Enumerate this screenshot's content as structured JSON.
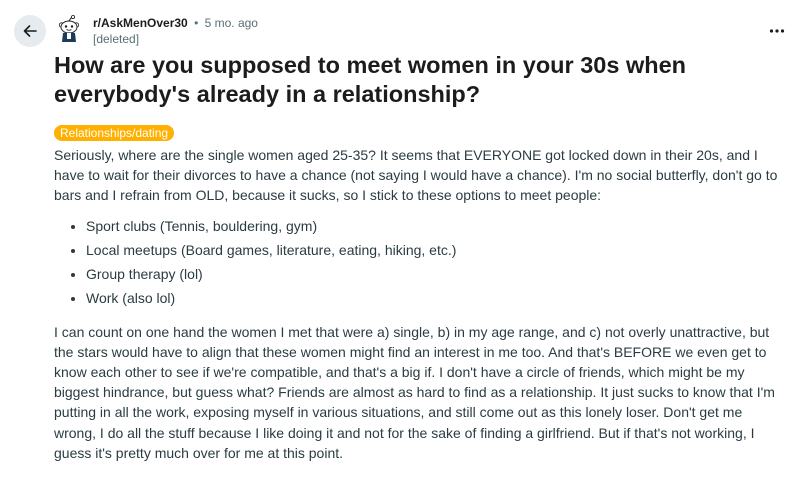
{
  "post": {
    "subreddit": "r/AskMenOver30",
    "separator": "•",
    "age": "5 mo. ago",
    "author": "[deleted]",
    "title": "How are you supposed to meet women in your 30s when everybody's already in a relationship?",
    "flair": "Relationships/dating",
    "flair_color": "#ffb000",
    "paragraph1": "Seriously, where are the single women aged 25-35? It seems that EVERYONE got locked down in their 20s, and I have to wait for their divorces to have a chance (not saying I would have a chance). I'm no social butterfly, don't go to bars and I refrain from OLD, because it sucks, so I stick to these options to meet people:",
    "list": [
      "Sport clubs (Tennis, bouldering, gym)",
      "Local meetups (Board games, literature, eating, hiking, etc.)",
      "Group therapy (lol)",
      "Work (also lol)"
    ],
    "paragraph2": "I can count on one hand the women I met that were a) single, b) in my age range, and c) not overly unattractive, but the stars would have to align that these women might find an interest in me too. And that's BEFORE we even get to know each other to see if we're compatible, and that's a big if. I don't have a circle of friends, which might be my biggest hindrance, but guess what? Friends are almost as hard to find as a relationship. It just sucks to know that I'm putting in all the work, exposing myself in various situations, and still come out as this lonely loser. Don't get me wrong, I do all the stuff because I like doing it and not for the sake of finding a girlfriend. But if that's not working, I guess it's pretty much over for me at this point."
  },
  "icons": {
    "back": "arrow-left-icon",
    "avatar": "snoo-avatar-icon",
    "more": "more-options-icon"
  }
}
